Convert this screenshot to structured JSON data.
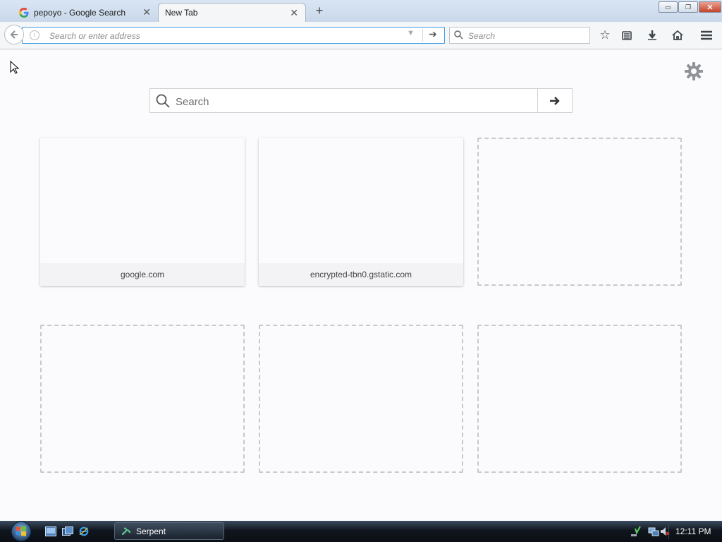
{
  "browser": {
    "tabs": [
      {
        "title": "pepoyo - Google Search",
        "favicon": "google-g-icon",
        "active": false
      },
      {
        "title": "New Tab",
        "active": true
      }
    ],
    "window_controls": {
      "minimize": "▭",
      "maximize": "❐",
      "close": "✕"
    },
    "toolbar": {
      "address_placeholder": "Search or enter address",
      "search_placeholder": "Search"
    }
  },
  "newtab": {
    "search_placeholder": "Search",
    "tiles": [
      {
        "label": "google.com",
        "empty": false
      },
      {
        "label": "encrypted-tbn0.gstatic.com",
        "empty": false
      },
      {
        "label": "",
        "empty": true
      },
      {
        "label": "",
        "empty": true
      },
      {
        "label": "",
        "empty": true
      },
      {
        "label": "",
        "empty": true
      }
    ]
  },
  "taskbar": {
    "task": "Serpent",
    "clock": "12:11 PM"
  },
  "colors": {
    "accent": "#3d9ee3",
    "taskbar": "#10161e"
  }
}
